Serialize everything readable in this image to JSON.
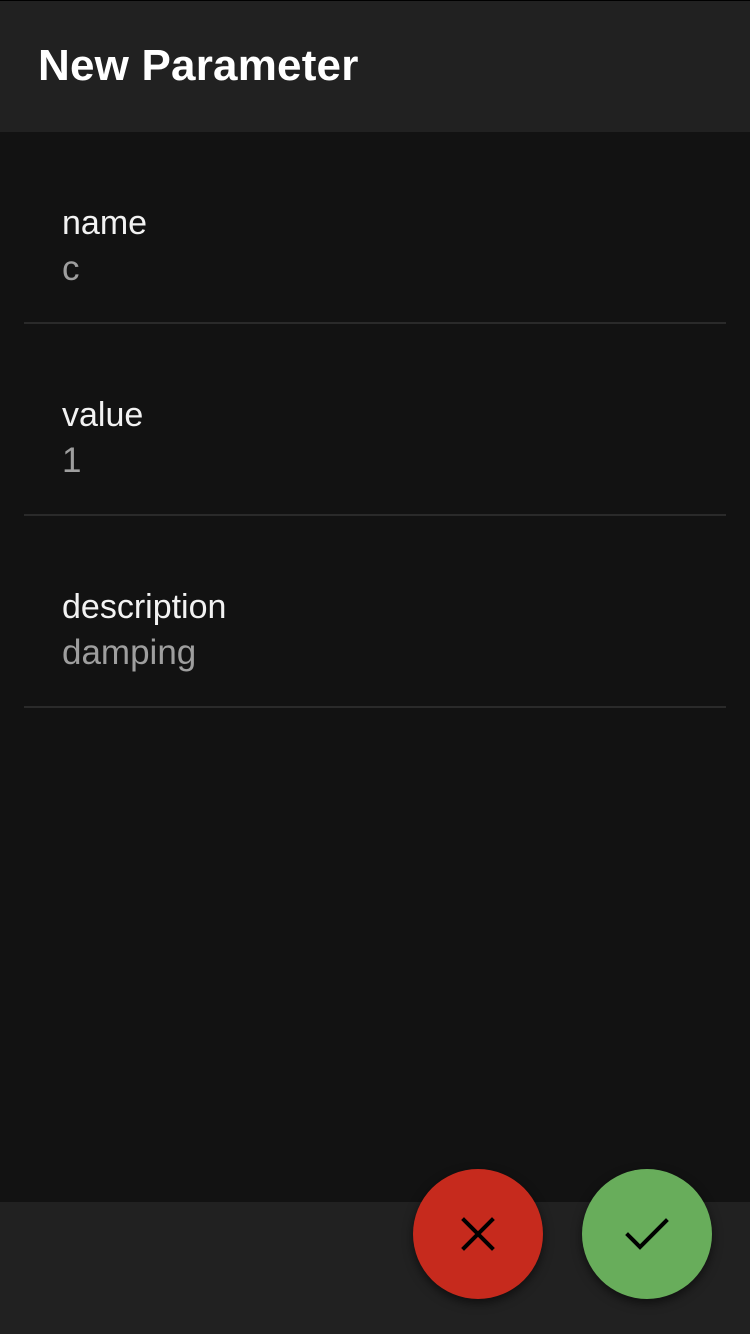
{
  "app_bar": {
    "title": "New Parameter"
  },
  "form": {
    "fields": [
      {
        "label": "name",
        "value": "c"
      },
      {
        "label": "value",
        "value": "1"
      },
      {
        "label": "description",
        "value": "damping"
      }
    ]
  },
  "actions": {
    "cancel": {
      "icon": "close-icon",
      "color": "#c62a1d"
    },
    "confirm": {
      "icon": "check-icon",
      "color": "#68ad5b"
    }
  },
  "colors": {
    "background": "#121212",
    "bar": "#212121"
  }
}
